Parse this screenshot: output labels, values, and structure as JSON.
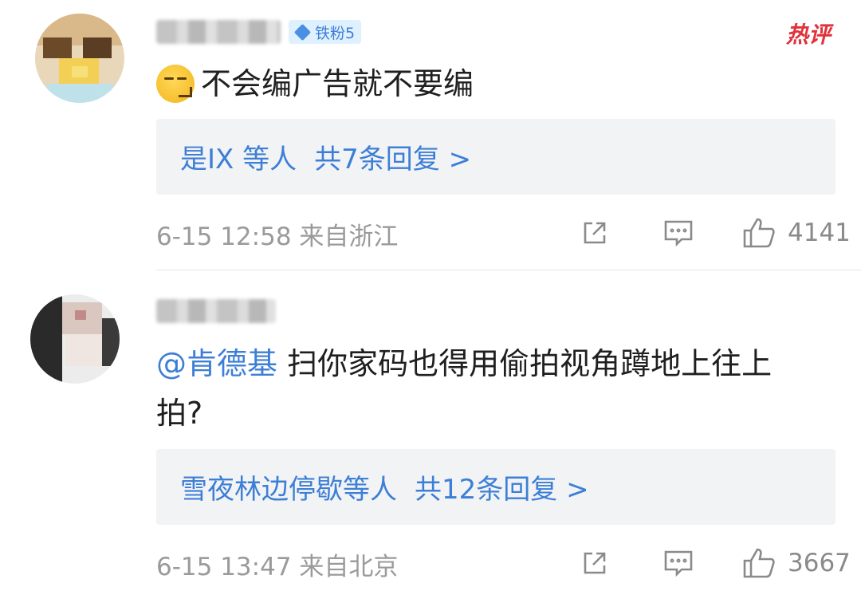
{
  "comments": [
    {
      "badge": "铁粉5",
      "hot_label": "热评",
      "text": "不会编广告就不要编",
      "replies": {
        "names": "是IX 等人",
        "summary": "共7条回复 >"
      },
      "meta": "6-15 12:58 来自浙江",
      "likes": "4141"
    },
    {
      "mention": "@肯德基",
      "text": " 扫你家码也得用偷拍视角蹲地上往上拍?",
      "replies": {
        "names": "雪夜林边停歇等人",
        "summary": "共12条回复 >"
      },
      "meta": "6-15 13:47 来自北京",
      "likes": "3667"
    }
  ],
  "icons": {
    "share": "share-icon",
    "comment": "comment-icon",
    "like": "thumbs-up-icon",
    "fan": "diamond-icon"
  },
  "colors": {
    "link": "#3d7fd6",
    "hot": "#e0323a",
    "badge_bg": "#dff0ff",
    "reply_bg": "#f2f3f5"
  }
}
